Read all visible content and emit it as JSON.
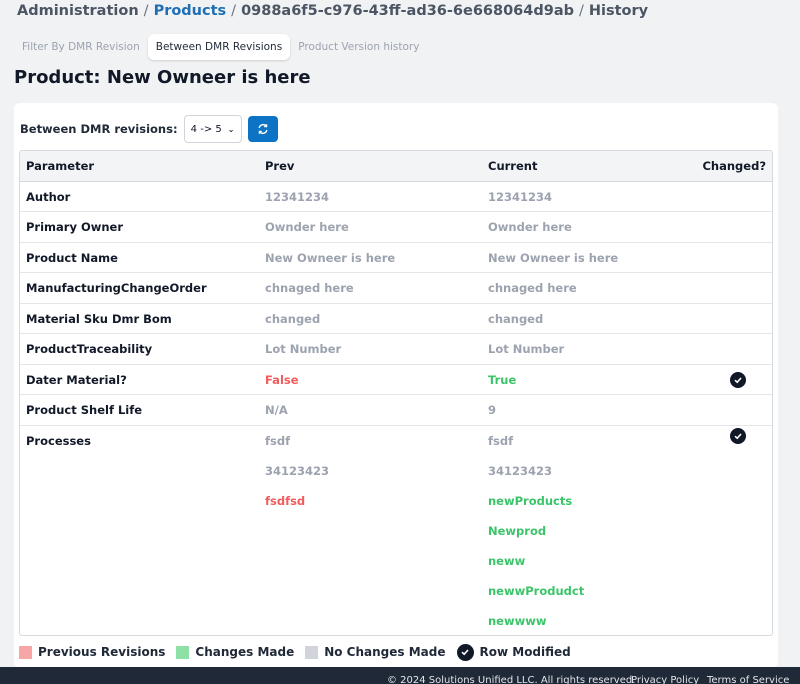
{
  "breadcrumb": {
    "root": "Administration",
    "products": "Products",
    "id": "0988a6f5-c976-43ff-ad36-6e668064d9ab",
    "current": "History",
    "separator": "/"
  },
  "tabs": [
    {
      "label": "Filter By DMR Revision",
      "active": false
    },
    {
      "label": "Between DMR Revisions",
      "active": true
    },
    {
      "label": "Product Version history",
      "active": false
    }
  ],
  "page_title": "Product: New Owneer is here",
  "revision": {
    "label": "Between DMR revisions:",
    "selected": "4 -> 5",
    "refresh_icon": "refresh-icon"
  },
  "table": {
    "headers": {
      "param": "Parameter",
      "prev": "Prev",
      "current": "Current",
      "changed": "Changed?"
    },
    "rows": [
      {
        "param": "Author",
        "prev": "12341234",
        "current": "12341234",
        "changed": false
      },
      {
        "param": "Primary Owner",
        "prev": "Ownder here",
        "current": "Ownder here",
        "changed": false
      },
      {
        "param": "Product Name",
        "prev": "New Owneer is here",
        "current": "New Owneer is here",
        "changed": false
      },
      {
        "param": "ManufacturingChangeOrder",
        "prev": "chnaged here",
        "current": "chnaged here",
        "changed": false
      },
      {
        "param": "Material Sku Dmr Bom",
        "prev": "changed",
        "current": "changed",
        "changed": false
      },
      {
        "param": "ProductTraceability",
        "prev": "Lot Number",
        "current": "Lot Number",
        "changed": false
      },
      {
        "param": "Dater Material?",
        "prev": "False",
        "current": "True",
        "changed": true
      },
      {
        "param": "Product Shelf Life",
        "prev": "N/A",
        "current": "9",
        "changed": false
      }
    ],
    "processes": {
      "param": "Processes",
      "prev": [
        "fsdf",
        "34123423",
        "fsdfsd"
      ],
      "current": [
        "fsdf",
        "34123423",
        "newProducts",
        "Newprod",
        "neww",
        "newwProdudct",
        "newwww"
      ],
      "changed": true
    }
  },
  "legend": {
    "previous": "Previous Revisions",
    "changes": "Changes Made",
    "no_changes": "No Changes Made",
    "row_modified": "Row Modified",
    "colors": {
      "previous": "#f8a5a5",
      "changes": "#8ee0a6",
      "no_changes": "#d1d5db"
    }
  },
  "footer": {
    "copyright": "© 2024 Solutions Unified LLC. All rights reserved.",
    "privacy": "Privacy Policy",
    "terms": "Terms of Service"
  }
}
